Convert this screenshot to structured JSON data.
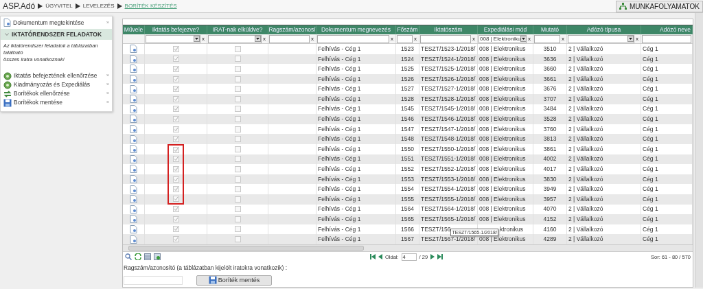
{
  "breadcrumb": [
    {
      "label": "ASP.Adó",
      "kind": "home",
      "selected": false
    },
    {
      "label": "ÜGYVITEL",
      "kind": "crumb",
      "selected": false
    },
    {
      "label": "LEVELEZÉS",
      "kind": "crumb",
      "selected": false
    },
    {
      "label": "BORÍTÉK KÉSZÍTÉS",
      "kind": "crumb",
      "selected": true
    }
  ],
  "workflow_button": "MUNKAFOLYAMATOK",
  "sidebar": {
    "top_item": {
      "label": "Dokumentum megtekintése",
      "arrow": "»"
    },
    "section": {
      "title": "IKTATÓRENDSZER FELADATOK",
      "expanded": true,
      "note": "Az iktatórendszer feladatok a táblázatban található\nösszes iratra vonatkoznak!"
    },
    "items": [
      {
        "label": "Iktatás befejeztének ellenőrzése",
        "arrow": "»"
      },
      {
        "label": "Kiadmányozás és Expediálás",
        "arrow": "»"
      },
      {
        "label": "Borítékok ellenőrzése",
        "arrow": "»"
      },
      {
        "label": "Borítékok mentése",
        "arrow": "»"
      }
    ]
  },
  "table": {
    "columns": [
      "Művele",
      "Iktatás befejezve?",
      "IRAT-nak elküldve?",
      "Ragszám/azonosí",
      "Dokumentum megnevezés",
      "Főszám",
      "Iktatószám",
      "Expediálási mód",
      "Mutató",
      "Adózó típusa",
      "Adózó neve"
    ],
    "filters": [
      {
        "kind": "none"
      },
      {
        "kind": "select",
        "clear": "x"
      },
      {
        "kind": "select",
        "clear": "x"
      },
      {
        "kind": "text",
        "clear": "x"
      },
      {
        "kind": "text",
        "clear": "x"
      },
      {
        "kind": "text",
        "clear": "x"
      },
      {
        "kind": "text",
        "clear": "x"
      },
      {
        "kind": "select",
        "value": "008 | Elektroniku",
        "clear": "x"
      },
      {
        "kind": "text",
        "clear": "x"
      },
      {
        "kind": "select",
        "clear": "x"
      },
      {
        "kind": "text"
      }
    ],
    "rows": [
      {
        "iktatas_done": true,
        "irat_sent": false,
        "marked": false,
        "document": "Felhívás - Cég 1",
        "foszam": "1523",
        "iktatoszam": "TESZT/1523-1/2018/",
        "expedialas": "008 | Elektronikus",
        "mutato": "3510",
        "adozo_tipus": "2 | Vállalkozó",
        "adozo_nev": "Cég 1"
      },
      {
        "iktatas_done": true,
        "irat_sent": false,
        "marked": false,
        "document": "Felhívás - Cég 1",
        "foszam": "1524",
        "iktatoszam": "TESZT/1524-1/2018/",
        "expedialas": "008 | Elektronikus",
        "mutato": "3636",
        "adozo_tipus": "2 | Vállalkozó",
        "adozo_nev": "Cég 1"
      },
      {
        "iktatas_done": true,
        "irat_sent": false,
        "marked": false,
        "document": "Felhívás - Cég 1",
        "foszam": "1525",
        "iktatoszam": "TESZT/1525-1/2018/",
        "expedialas": "008 | Elektronikus",
        "mutato": "3660",
        "adozo_tipus": "2 | Vállalkozó",
        "adozo_nev": "Cég 1"
      },
      {
        "iktatas_done": true,
        "irat_sent": false,
        "marked": false,
        "document": "Felhívás - Cég 1",
        "foszam": "1526",
        "iktatoszam": "TESZT/1526-1/2018/",
        "expedialas": "008 | Elektronikus",
        "mutato": "3661",
        "adozo_tipus": "2 | Vállalkozó",
        "adozo_nev": "Cég 1"
      },
      {
        "iktatas_done": true,
        "irat_sent": false,
        "marked": false,
        "document": "Felhívás - Cég 1",
        "foszam": "1527",
        "iktatoszam": "TESZT/1527-1/2018/",
        "expedialas": "008 | Elektronikus",
        "mutato": "3676",
        "adozo_tipus": "2 | Vállalkozó",
        "adozo_nev": "Cég 1"
      },
      {
        "iktatas_done": true,
        "irat_sent": false,
        "marked": false,
        "document": "Felhívás - Cég 1",
        "foszam": "1528",
        "iktatoszam": "TESZT/1528-1/2018/",
        "expedialas": "008 | Elektronikus",
        "mutato": "3707",
        "adozo_tipus": "2 | Vállalkozó",
        "adozo_nev": "Cég 1"
      },
      {
        "iktatas_done": true,
        "irat_sent": false,
        "marked": false,
        "document": "Felhívás - Cég 1",
        "foszam": "1545",
        "iktatoszam": "TESZT/1545-1/2018/",
        "expedialas": "008 | Elektronikus",
        "mutato": "3484",
        "adozo_tipus": "2 | Vállalkozó",
        "adozo_nev": "Cég 1"
      },
      {
        "iktatas_done": true,
        "irat_sent": false,
        "marked": false,
        "document": "Felhívás - Cég 1",
        "foszam": "1546",
        "iktatoszam": "TESZT/1546-1/2018/",
        "expedialas": "008 | Elektronikus",
        "mutato": "3528",
        "adozo_tipus": "2 | Vállalkozó",
        "adozo_nev": "Cég 1"
      },
      {
        "iktatas_done": true,
        "irat_sent": false,
        "marked": false,
        "document": "Felhívás - Cég 1",
        "foszam": "1547",
        "iktatoszam": "TESZT/1547-1/2018/",
        "expedialas": "008 | Elektronikus",
        "mutato": "3760",
        "adozo_tipus": "2 | Vállalkozó",
        "adozo_nev": "Cég 1"
      },
      {
        "iktatas_done": true,
        "irat_sent": false,
        "marked": false,
        "document": "Felhívás - Cég 1",
        "foszam": "1548",
        "iktatoszam": "TESZT/1548-1/2018/",
        "expedialas": "008 | Elektronikus",
        "mutato": "3813",
        "adozo_tipus": "2 | Vállalkozó",
        "adozo_nev": "Cég 1"
      },
      {
        "iktatas_done": true,
        "irat_sent": false,
        "marked": true,
        "document": "Felhívás - Cég 1",
        "foszam": "1550",
        "iktatoszam": "TESZT/1550-1/2018/",
        "expedialas": "008 | Elektronikus",
        "mutato": "3861",
        "adozo_tipus": "2 | Vállalkozó",
        "adozo_nev": "Cég 1"
      },
      {
        "iktatas_done": true,
        "irat_sent": false,
        "marked": true,
        "document": "Felhívás - Cég 1",
        "foszam": "1551",
        "iktatoszam": "TESZT/1551-1/2018/",
        "expedialas": "008 | Elektronikus",
        "mutato": "4002",
        "adozo_tipus": "2 | Vállalkozó",
        "adozo_nev": "Cég 1"
      },
      {
        "iktatas_done": true,
        "irat_sent": false,
        "marked": true,
        "document": "Felhívás - Cég 1",
        "foszam": "1552",
        "iktatoszam": "TESZT/1552-1/2018/",
        "expedialas": "008 | Elektronikus",
        "mutato": "4017",
        "adozo_tipus": "2 | Vállalkozó",
        "adozo_nev": "Cég 1"
      },
      {
        "iktatas_done": true,
        "irat_sent": false,
        "marked": true,
        "document": "Felhívás - Cég 1",
        "foszam": "1553",
        "iktatoszam": "TESZT/1553-1/2018/",
        "expedialas": "008 | Elektronikus",
        "mutato": "3830",
        "adozo_tipus": "2 | Vállalkozó",
        "adozo_nev": "Cég 1"
      },
      {
        "iktatas_done": true,
        "irat_sent": false,
        "marked": true,
        "document": "Felhívás - Cég 1",
        "foszam": "1554",
        "iktatoszam": "TESZT/1554-1/2018/",
        "expedialas": "008 | Elektronikus",
        "mutato": "3949",
        "adozo_tipus": "2 | Vállalkozó",
        "adozo_nev": "Cég 1"
      },
      {
        "iktatas_done": true,
        "irat_sent": false,
        "marked": true,
        "document": "Felhívás - Cég 1",
        "foszam": "1555",
        "iktatoszam": "TESZT/1555-1/2018/",
        "expedialas": "008 | Elektronikus",
        "mutato": "3957",
        "adozo_tipus": "2 | Vállalkozó",
        "adozo_nev": "Cég 1"
      },
      {
        "iktatas_done": true,
        "irat_sent": false,
        "marked": false,
        "document": "Felhívás - Cég 1",
        "foszam": "1564",
        "iktatoszam": "TESZT/1564-1/2018/",
        "expedialas": "008 | Elektronikus",
        "mutato": "4070",
        "adozo_tipus": "2 | Vállalkozó",
        "adozo_nev": "Cég 1"
      },
      {
        "iktatas_done": true,
        "irat_sent": false,
        "marked": false,
        "document": "Felhívás - Cég 1",
        "foszam": "1565",
        "iktatoszam": "TESZT/1565-1/2018/",
        "expedialas": "008 | Elektronikus",
        "mutato": "4152",
        "adozo_tipus": "2 | Vállalkozó",
        "adozo_nev": "Cég 1"
      },
      {
        "iktatas_done": true,
        "irat_sent": false,
        "marked": false,
        "document": "Felhívás - Cég 1",
        "foszam": "1566",
        "iktatoszam": "TESZT/156",
        "tooltip": "TESZT/1565-1/2018/",
        "expedialas": "ktronikus",
        "mutato": "4160",
        "adozo_tipus": "2 | Vállalkozó",
        "adozo_nev": "Cég 1"
      },
      {
        "iktatas_done": true,
        "irat_sent": false,
        "marked": false,
        "document": "Felhívás - Cég 1",
        "foszam": "1567",
        "iktatoszam": "TESZT/1567-1/2018/",
        "expedialas": "008 | Elektronikus",
        "mutato": "4289",
        "adozo_tipus": "2 | Vállalkozó",
        "adozo_nev": "Cég 1"
      }
    ],
    "pager": {
      "label": "Oldal:",
      "page": "4",
      "total": "/ 29",
      "summary": "Sor: 61 - 80 / 570"
    }
  },
  "form": {
    "label": "Ragszám/azonosító (a táblázatban kijelölt iratokra vonatkozik) :",
    "button": "Boríték mentés"
  }
}
